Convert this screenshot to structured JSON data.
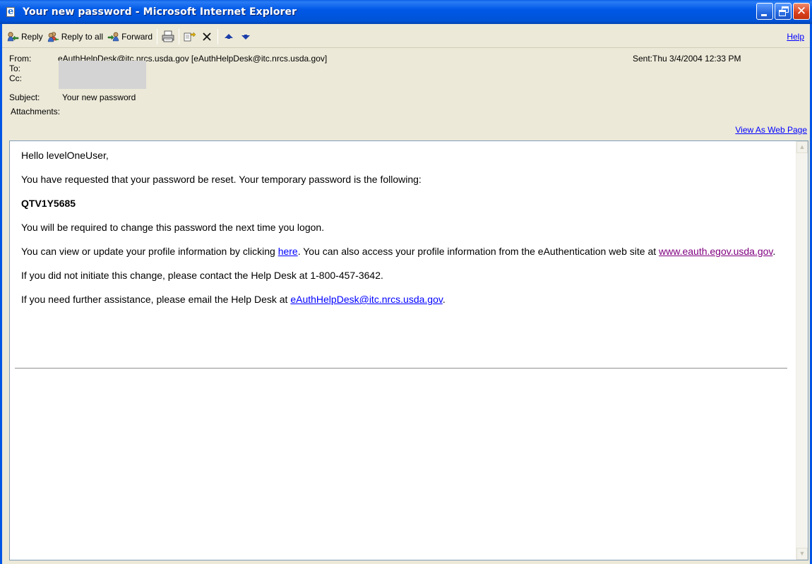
{
  "window": {
    "title": "Your new password - Microsoft Internet Explorer"
  },
  "toolbar": {
    "reply": "Reply",
    "reply_all": "Reply to all",
    "forward": "Forward",
    "help": "Help"
  },
  "header": {
    "from_label": "From:",
    "from_value": "eAuthHelpDesk@itc.nrcs.usda.gov [eAuthHelpDesk@itc.nrcs.usda.gov]",
    "sent": "Sent:Thu 3/4/2004 12:33 PM",
    "to_label": "To:",
    "cc_label": "Cc:",
    "subject_label": "Subject:",
    "subject_value": "Your new password",
    "attachments_label": "Attachments:",
    "view_as_web": "View As Web Page"
  },
  "message": {
    "greeting": "Hello levelOneUser,",
    "line1": "You have requested that your password be reset. Your temporary password is the following:",
    "password": "QTV1Y5685",
    "line2": "You will be required to change this password the next time you logon.",
    "line3_a": "You can view or update your profile information by clicking ",
    "line3_link": "here",
    "line3_b": ". You can also access your profile information from the eAuthentication web site at ",
    "line3_link2": "www.eauth.egov.usda.gov",
    "line3_c": ".",
    "line4": "If you did not initiate this change, please contact the Help Desk at 1-800-457-3642.",
    "line5_a": "If you need further assistance, please email the Help Desk at ",
    "line5_link": "eAuthHelpDesk@itc.nrcs.usda.gov",
    "line5_b": "."
  },
  "icons": {
    "app": "ie-page-icon",
    "reply": "reply-icon",
    "reply_all": "reply-all-icon",
    "forward": "forward-icon",
    "print": "print-icon",
    "move": "move-to-folder-icon",
    "delete": "delete-icon",
    "previous": "up-arrow-icon",
    "next": "down-arrow-icon"
  }
}
